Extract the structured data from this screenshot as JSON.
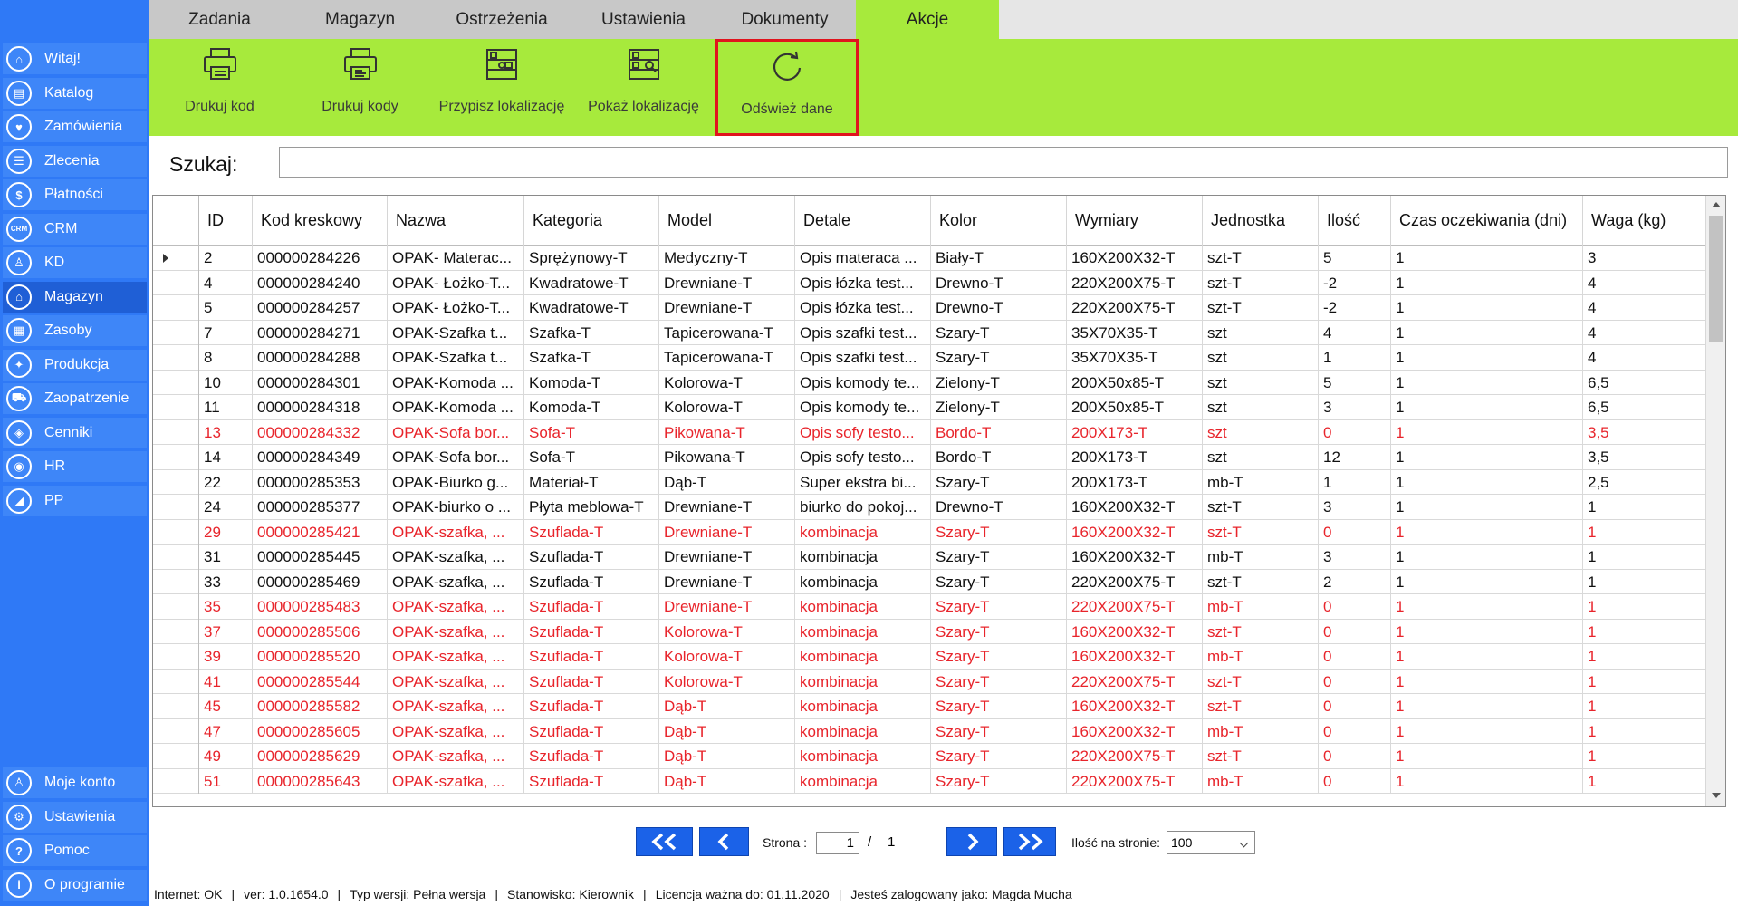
{
  "sidebar": {
    "items": [
      {
        "label": "Witaj!",
        "icon": "home-icon",
        "glyph": "⌂"
      },
      {
        "label": "Katalog",
        "icon": "book-icon",
        "glyph": "▤"
      },
      {
        "label": "Zamówienia",
        "icon": "cart-icon",
        "glyph": "♥"
      },
      {
        "label": "Zlecenia",
        "icon": "list-icon",
        "glyph": "☰"
      },
      {
        "label": "Płatności",
        "icon": "dollar-icon",
        "glyph": "$"
      },
      {
        "label": "CRM",
        "icon": "crm-icon",
        "glyph": "CRM"
      },
      {
        "label": "KD",
        "icon": "person-icon",
        "glyph": "♙"
      },
      {
        "label": "Magazyn",
        "icon": "warehouse-icon",
        "glyph": "⌂"
      },
      {
        "label": "Zasoby",
        "icon": "resources-icon",
        "glyph": "▦"
      },
      {
        "label": "Produkcja",
        "icon": "production-icon",
        "glyph": "✦"
      },
      {
        "label": "Zaopatrzenie",
        "icon": "truck-icon",
        "glyph": "⛟"
      },
      {
        "label": "Cenniki",
        "icon": "tag-icon",
        "glyph": "◈"
      },
      {
        "label": "HR",
        "icon": "hr-icon",
        "glyph": "◉"
      },
      {
        "label": "PP",
        "icon": "chart-icon",
        "glyph": "◢"
      }
    ],
    "bottom_items": [
      {
        "label": "Moje konto",
        "icon": "account-icon",
        "glyph": "♙"
      },
      {
        "label": "Ustawienia",
        "icon": "settings-icon",
        "glyph": "⚙"
      },
      {
        "label": "Pomoc",
        "icon": "help-icon",
        "glyph": "?"
      },
      {
        "label": "O programie",
        "icon": "info-icon",
        "glyph": "i"
      }
    ]
  },
  "tabs": [
    {
      "label": "Zadania"
    },
    {
      "label": "Magazyn"
    },
    {
      "label": "Ostrzeżenia"
    },
    {
      "label": "Ustawienia"
    },
    {
      "label": "Dokumenty"
    },
    {
      "label": "Akcje"
    }
  ],
  "ribbon": {
    "buttons": [
      {
        "label": "Drukuj kod",
        "icon": "printer-icon"
      },
      {
        "label": "Drukuj kody",
        "icon": "printer-multi-icon"
      },
      {
        "label": "Przypisz lokalizację",
        "icon": "shelf-assign-icon"
      },
      {
        "label": "Pokaż lokalizację",
        "icon": "shelf-show-icon"
      },
      {
        "label": "Odśwież dane",
        "icon": "refresh-icon"
      }
    ]
  },
  "search": {
    "label": "Szukaj:",
    "value": ""
  },
  "grid": {
    "columns": [
      "ID",
      "Kod kreskowy",
      "Nazwa",
      "Kategoria",
      "Model",
      "Detale",
      "Kolor",
      "Wymiary",
      "Jednostka",
      "Ilość",
      "Czas oczekiwania (dni)",
      "Waga (kg)"
    ],
    "rows": [
      {
        "red": false,
        "current": true,
        "cells": [
          "2",
          "000000284226",
          "OPAK- Materac...",
          "Sprężynowy-T",
          "Medyczny-T",
          "Opis materaca ...",
          "Biały-T",
          "160X200X32-T",
          "szt-T",
          "5",
          "1",
          "3"
        ]
      },
      {
        "red": false,
        "cells": [
          "4",
          "000000284240",
          "OPAK- Łożko-T...",
          "Kwadratowe-T",
          "Drewniane-T",
          "Opis łózka test...",
          "Drewno-T",
          "220X200X75-T",
          "szt-T",
          "-2",
          "1",
          "4"
        ]
      },
      {
        "red": false,
        "cells": [
          "5",
          "000000284257",
          "OPAK- Łożko-T...",
          "Kwadratowe-T",
          "Drewniane-T",
          "Opis łózka test...",
          "Drewno-T",
          "220X200X75-T",
          "szt-T",
          "-2",
          "1",
          "4"
        ]
      },
      {
        "red": false,
        "cells": [
          "7",
          "000000284271",
          "OPAK-Szafka t...",
          "Szafka-T",
          "Tapicerowana-T",
          "Opis szafki test...",
          "Szary-T",
          "35X70X35-T",
          "szt",
          "4",
          "1",
          "4"
        ]
      },
      {
        "red": false,
        "cells": [
          "8",
          "000000284288",
          "OPAK-Szafka t...",
          "Szafka-T",
          "Tapicerowana-T",
          "Opis szafki test...",
          "Szary-T",
          "35X70X35-T",
          "szt",
          "1",
          "1",
          "4"
        ]
      },
      {
        "red": false,
        "cells": [
          "10",
          "000000284301",
          "OPAK-Komoda ...",
          "Komoda-T",
          "Kolorowa-T",
          "Opis komody te...",
          "Zielony-T",
          "200X50x85-T",
          "szt",
          "5",
          "1",
          "6,5"
        ]
      },
      {
        "red": false,
        "cells": [
          "11",
          "000000284318",
          "OPAK-Komoda ...",
          "Komoda-T",
          "Kolorowa-T",
          "Opis komody te...",
          "Zielony-T",
          "200X50x85-T",
          "szt",
          "3",
          "1",
          "6,5"
        ]
      },
      {
        "red": true,
        "cells": [
          "13",
          "000000284332",
          "OPAK-Sofa bor...",
          "Sofa-T",
          "Pikowana-T",
          "Opis sofy testo...",
          "Bordo-T",
          "200X173-T",
          "szt",
          "0",
          "1",
          "3,5"
        ]
      },
      {
        "red": false,
        "cells": [
          "14",
          "000000284349",
          "OPAK-Sofa bor...",
          "Sofa-T",
          "Pikowana-T",
          "Opis sofy testo...",
          "Bordo-T",
          "200X173-T",
          "szt",
          "12",
          "1",
          "3,5"
        ]
      },
      {
        "red": false,
        "cells": [
          "22",
          "000000285353",
          "OPAK-Biurko g...",
          "Materiał-T",
          "Dąb-T",
          "Super ekstra bi...",
          "Szary-T",
          "200X173-T",
          "mb-T",
          "1",
          "1",
          "2,5"
        ]
      },
      {
        "red": false,
        "cells": [
          "24",
          "000000285377",
          "OPAK-biurko o ...",
          "Płyta meblowa-T",
          "Drewniane-T",
          "biurko do pokoj...",
          "Drewno-T",
          "160X200X32-T",
          "szt-T",
          "3",
          "1",
          "1"
        ]
      },
      {
        "red": true,
        "cells": [
          "29",
          "000000285421",
          "OPAK-szafka, ...",
          "Szuflada-T",
          "Drewniane-T",
          "kombinacja",
          "Szary-T",
          "160X200X32-T",
          "szt-T",
          "0",
          "1",
          "1"
        ]
      },
      {
        "red": false,
        "cells": [
          "31",
          "000000285445",
          "OPAK-szafka, ...",
          "Szuflada-T",
          "Drewniane-T",
          "kombinacja",
          "Szary-T",
          "160X200X32-T",
          "mb-T",
          "3",
          "1",
          "1"
        ]
      },
      {
        "red": false,
        "cells": [
          "33",
          "000000285469",
          "OPAK-szafka, ...",
          "Szuflada-T",
          "Drewniane-T",
          "kombinacja",
          "Szary-T",
          "220X200X75-T",
          "szt-T",
          "2",
          "1",
          "1"
        ]
      },
      {
        "red": true,
        "cells": [
          "35",
          "000000285483",
          "OPAK-szafka, ...",
          "Szuflada-T",
          "Drewniane-T",
          "kombinacja",
          "Szary-T",
          "220X200X75-T",
          "mb-T",
          "0",
          "1",
          "1"
        ]
      },
      {
        "red": true,
        "cells": [
          "37",
          "000000285506",
          "OPAK-szafka, ...",
          "Szuflada-T",
          "Kolorowa-T",
          "kombinacja",
          "Szary-T",
          "160X200X32-T",
          "szt-T",
          "0",
          "1",
          "1"
        ]
      },
      {
        "red": true,
        "cells": [
          "39",
          "000000285520",
          "OPAK-szafka, ...",
          "Szuflada-T",
          "Kolorowa-T",
          "kombinacja",
          "Szary-T",
          "160X200X32-T",
          "mb-T",
          "0",
          "1",
          "1"
        ]
      },
      {
        "red": true,
        "cells": [
          "41",
          "000000285544",
          "OPAK-szafka, ...",
          "Szuflada-T",
          "Kolorowa-T",
          "kombinacja",
          "Szary-T",
          "220X200X75-T",
          "szt-T",
          "0",
          "1",
          "1"
        ]
      },
      {
        "red": true,
        "cells": [
          "45",
          "000000285582",
          "OPAK-szafka, ...",
          "Szuflada-T",
          "Dąb-T",
          "kombinacja",
          "Szary-T",
          "160X200X32-T",
          "szt-T",
          "0",
          "1",
          "1"
        ]
      },
      {
        "red": true,
        "cells": [
          "47",
          "000000285605",
          "OPAK-szafka, ...",
          "Szuflada-T",
          "Dąb-T",
          "kombinacja",
          "Szary-T",
          "160X200X32-T",
          "mb-T",
          "0",
          "1",
          "1"
        ]
      },
      {
        "red": true,
        "cells": [
          "49",
          "000000285629",
          "OPAK-szafka, ...",
          "Szuflada-T",
          "Dąb-T",
          "kombinacja",
          "Szary-T",
          "220X200X75-T",
          "szt-T",
          "0",
          "1",
          "1"
        ]
      },
      {
        "red": true,
        "cells": [
          "51",
          "000000285643",
          "OPAK-szafka, ...",
          "Szuflada-T",
          "Dąb-T",
          "kombinacja",
          "Szary-T",
          "220X200X75-T",
          "mb-T",
          "0",
          "1",
          "1"
        ]
      }
    ]
  },
  "pager": {
    "page_label": "Strona :",
    "page": "1",
    "separator": "/",
    "total": "1",
    "per_page_label": "Ilość na stronie:",
    "per_page": "100"
  },
  "status": {
    "internet": "Internet: OK",
    "version": "ver: 1.0.1654.0",
    "type": "Typ wersji: Pełna wersja",
    "station": "Stanowisko: Kierownik",
    "license": "Licencja ważna do: 01.11.2020",
    "user": "Jesteś zalogowany jako: Magda Mucha"
  },
  "colors": {
    "sidebar": "#2f79f6",
    "ribbon": "#a7ea3c",
    "red_row": "#e8242b",
    "pager_button": "#1b62e8",
    "highlight_border": "#e0141e"
  }
}
